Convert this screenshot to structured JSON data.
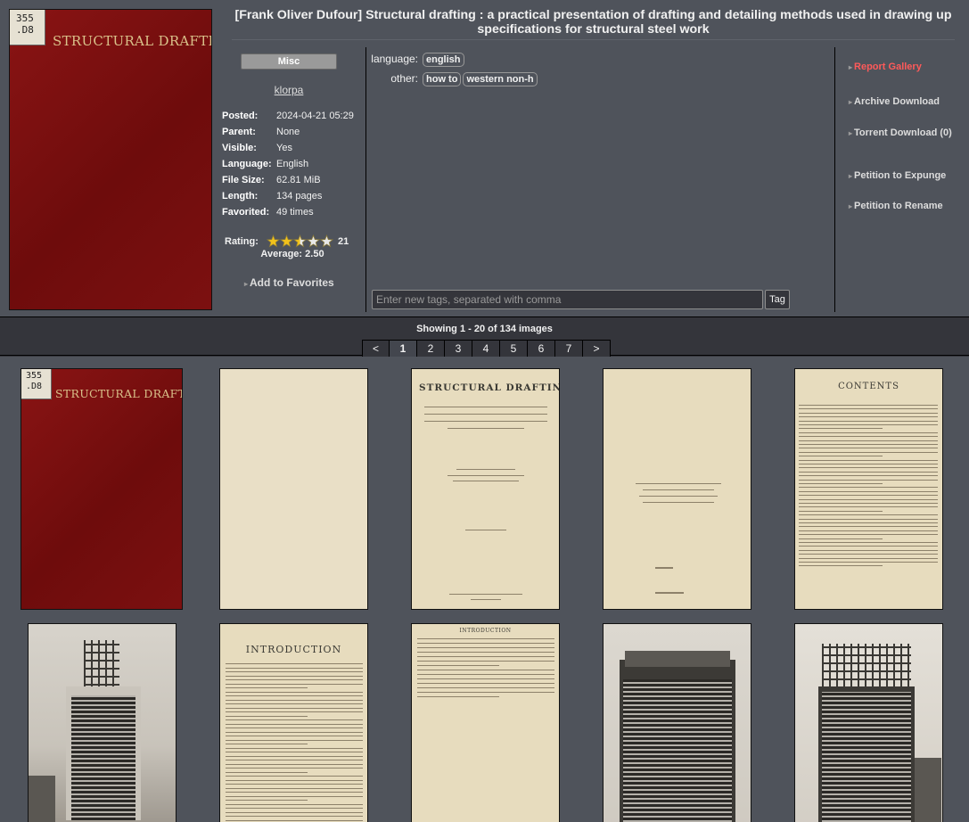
{
  "gallery": {
    "title": "[Frank Oliver Dufour] Structural drafting : a practical presentation of drafting and detailing methods used in drawing up specifications for structural steel work",
    "cover_label": "355 .D8",
    "cover_title": "STRUCTURAL DRAFTING",
    "category": "Misc",
    "uploader": "klorpa"
  },
  "meta": [
    {
      "key": "Posted:",
      "value": "2024-04-21 05:29"
    },
    {
      "key": "Parent:",
      "value": "None"
    },
    {
      "key": "Visible:",
      "value": "Yes"
    },
    {
      "key": "Language:",
      "value": "English"
    },
    {
      "key": "File Size:",
      "value": "62.81 MiB"
    },
    {
      "key": "Length:",
      "value": "134 pages"
    },
    {
      "key": "Favorited:",
      "value": "49 times"
    }
  ],
  "rating": {
    "label": "Rating:",
    "count": "21",
    "average_text": "Average: 2.50",
    "stars_value": 2.5,
    "stars_max": 5
  },
  "favorites_label": "Add to Favorites",
  "tags": [
    {
      "namespace": "language:",
      "tags": [
        "english"
      ]
    },
    {
      "namespace": "other:",
      "tags": [
        "how to",
        "western non-h"
      ]
    }
  ],
  "tag_input": {
    "placeholder": "Enter new tags, separated with comma",
    "button": "Tag"
  },
  "actions": [
    {
      "label": "Report Gallery",
      "accent": true
    },
    {
      "label": "Archive Download",
      "accent": false
    },
    {
      "label": "Torrent Download (0)",
      "accent": false
    },
    {
      "label": "Petition to Expunge",
      "accent": false
    },
    {
      "label": "Petition to Rename",
      "accent": false
    }
  ],
  "pagination": {
    "showing": "Showing 1 - 20 of 134 images",
    "prev": "<",
    "next": ">",
    "pages": [
      "1",
      "2",
      "3",
      "4",
      "5",
      "6",
      "7"
    ],
    "current": "1"
  },
  "thumbnails": {
    "cover_label": "355 .D8",
    "cover_title": "STRUCTURAL DRAFTING",
    "titlepage_title": "STRUCTURAL DRAFTING",
    "introduction_heading": "INTRODUCTION",
    "introduction_small": "INTRODUCTION",
    "contents_heading": "CONTENTS"
  },
  "colors": {
    "page_bg": "#34353b",
    "panel_bg": "#4f535b",
    "accent_red": "#ff5a5a",
    "cover_red": "#7a1010",
    "star_gold": "#f2c21b"
  }
}
